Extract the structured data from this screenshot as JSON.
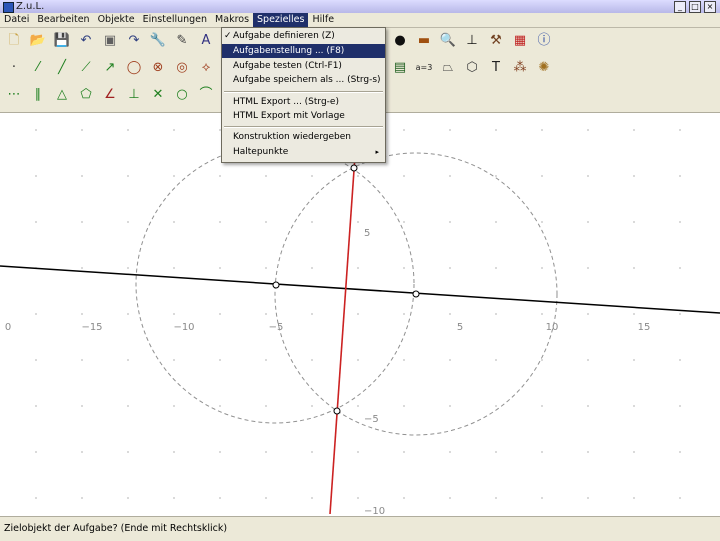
{
  "window": {
    "title": "Z.u.L."
  },
  "menubar": {
    "items": [
      {
        "label": "Datei"
      },
      {
        "label": "Bearbeiten"
      },
      {
        "label": "Objekte"
      },
      {
        "label": "Einstellungen"
      },
      {
        "label": "Makros"
      },
      {
        "label": "Spezielles"
      },
      {
        "label": "Hilfe"
      }
    ]
  },
  "dropdown": {
    "items": [
      {
        "label": "Aufgabe definieren (Z)",
        "checked": true
      },
      {
        "label": "Aufgabenstellung ... (F8)",
        "highlighted": true
      },
      {
        "label": "Aufgabe testen (Ctrl-F1)"
      },
      {
        "label": "Aufgabe speichern als ... (Strg-s)"
      },
      {
        "label": "HTML Export ... (Strg-e)"
      },
      {
        "label": "HTML Export mit Vorlage"
      },
      {
        "label": "Konstruktion wiedergeben"
      },
      {
        "label": "Haltepunkte"
      }
    ],
    "check_glyph": "✓",
    "submenu_glyph": "▸"
  },
  "toolbar": {
    "row1": [
      {
        "icon": "new-file-icon",
        "glyph": "🗋",
        "color": "#c8a040"
      },
      {
        "icon": "open-folder-icon",
        "glyph": "📂",
        "color": "#d8b040"
      },
      {
        "icon": "save-disk-icon",
        "glyph": "💾",
        "color": "#6060a0"
      },
      {
        "icon": "undo-icon",
        "glyph": "↶",
        "color": "#304080"
      },
      {
        "icon": "hide-icon",
        "glyph": "▣",
        "color": "#606060"
      },
      {
        "icon": "redo-icon",
        "glyph": "↷",
        "color": "#304080"
      },
      {
        "icon": "edit-wrench-icon",
        "glyph": "🔧",
        "color": "#806040"
      },
      {
        "icon": "delete-icon",
        "glyph": "✎",
        "color": "#404040"
      },
      {
        "icon": "text-icon",
        "glyph": "A",
        "color": "#303080"
      }
    ],
    "row2": [
      {
        "icon": "point-icon",
        "glyph": "·",
        "color": "#303030"
      },
      {
        "icon": "segment-icon",
        "glyph": "⁄",
        "color": "#208020"
      },
      {
        "icon": "line-icon",
        "glyph": "╱",
        "color": "#208020"
      },
      {
        "icon": "ray-icon",
        "glyph": "⟋",
        "color": "#208020"
      },
      {
        "icon": "vector-icon",
        "glyph": "↗",
        "color": "#208020"
      },
      {
        "icon": "circle-icon",
        "glyph": "◯",
        "color": "#a04020"
      },
      {
        "icon": "circle-fixed-icon",
        "glyph": "⊗",
        "color": "#a04020"
      },
      {
        "icon": "circle-3pt-icon",
        "glyph": "◎",
        "color": "#a04020"
      },
      {
        "icon": "compass-icon",
        "glyph": "⟡",
        "color": "#a04020"
      }
    ],
    "row3": [
      {
        "icon": "midpoint-icon",
        "glyph": "⋯",
        "color": "#208020"
      },
      {
        "icon": "parallel-icon",
        "glyph": "∥",
        "color": "#208020"
      },
      {
        "icon": "triangle-icon",
        "glyph": "△",
        "color": "#208020"
      },
      {
        "icon": "polygon-icon",
        "glyph": "⬠",
        "color": "#208020"
      },
      {
        "icon": "angle-icon",
        "glyph": "∠",
        "color": "#a02020"
      },
      {
        "icon": "perpendicular-icon",
        "glyph": "⊥",
        "color": "#208020"
      },
      {
        "icon": "intersection-icon",
        "glyph": "✕",
        "color": "#208020"
      },
      {
        "icon": "circle-outline-icon",
        "glyph": "○",
        "color": "#208020"
      },
      {
        "icon": "arc-icon",
        "glyph": "⌒",
        "color": "#208020"
      }
    ],
    "right1": [
      {
        "icon": "dot-icon",
        "glyph": "●",
        "color": "#101010"
      },
      {
        "icon": "line-style-icon",
        "glyph": "▬",
        "color": "#a05010"
      },
      {
        "icon": "zoom-icon",
        "glyph": "🔍",
        "color": "#404080"
      },
      {
        "icon": "axes-icon",
        "glyph": "⊥",
        "color": "#101010"
      },
      {
        "icon": "tools-icon",
        "glyph": "⚒",
        "color": "#704020"
      },
      {
        "icon": "color-palette-icon",
        "glyph": "▦",
        "color": "#c02020"
      },
      {
        "icon": "info-icon",
        "glyph": "ⓘ",
        "color": "#2040a0"
      }
    ],
    "right2": [
      {
        "icon": "film-icon",
        "glyph": "▤",
        "color": "#206020"
      },
      {
        "icon": "expression-icon",
        "glyph": "a=3",
        "color": "#202020"
      },
      {
        "icon": "quadrilateral-icon",
        "glyph": "⏢",
        "color": "#404040"
      },
      {
        "icon": "locus-icon",
        "glyph": "⬡",
        "color": "#404040"
      },
      {
        "icon": "text-tool-icon",
        "glyph": "T",
        "color": "#202020"
      },
      {
        "icon": "magic-wand-icon",
        "glyph": "⁂",
        "color": "#804020"
      },
      {
        "icon": "gear-icon",
        "glyph": "✺",
        "color": "#a07020"
      }
    ]
  },
  "canvas": {
    "x_tick_labels": [
      "0",
      "−15",
      "−10",
      "−5",
      "5",
      "10",
      "15"
    ],
    "y_tick_labels": [
      "5",
      "−5",
      "−10"
    ],
    "colors": {
      "grid": "#c0c0c0",
      "circle": "#909090",
      "black_line": "#000000",
      "red_line": "#cc2222"
    }
  },
  "status": {
    "text": "Zielobjekt der Aufgabe? (Ende mit Rechtsklick)"
  }
}
